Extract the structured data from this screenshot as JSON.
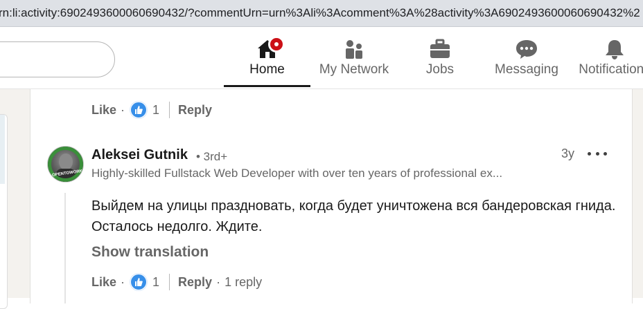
{
  "browser": {
    "url": "rn:li:activity:6902493600060690432/?commentUrn=urn%3Ali%3Acomment%3A%28activity%3A6902493600060690432%2"
  },
  "nav": {
    "items": [
      {
        "label": "Home",
        "icon": "home-icon",
        "active": true
      },
      {
        "label": "My Network",
        "icon": "my-network-icon"
      },
      {
        "label": "Jobs",
        "icon": "briefcase-icon"
      },
      {
        "label": "Messaging",
        "icon": "messaging-icon"
      },
      {
        "label": "Notifications",
        "icon": "bell-icon"
      }
    ]
  },
  "previous_comment": {
    "like_label": "Like",
    "separator": "·",
    "like_count": "1",
    "reply_label": "Reply"
  },
  "comment": {
    "author_name": "Aleksei Gutnik",
    "author_degree": "• 3rd+",
    "author_headline": "Highly-skilled Fullstack Web Developer with over ten years of professional ex...",
    "avatar_text": "OPENTOWORK",
    "timestamp": "3y",
    "text": "Выйдем на улицы праздновать, когда будет уничтожена вся бандеровская гнида. Осталось недолго. Ждите.",
    "show_translation_label": "Show translation",
    "like_label": "Like",
    "separator": "·",
    "like_count": "1",
    "reply_label": "Reply",
    "replies_label": "1 reply"
  },
  "colors": {
    "brand_blue": "#378fe9",
    "notification_red": "#cc1016",
    "open_to_work_green": "#3a8f3a",
    "muted_text": "#666666"
  }
}
